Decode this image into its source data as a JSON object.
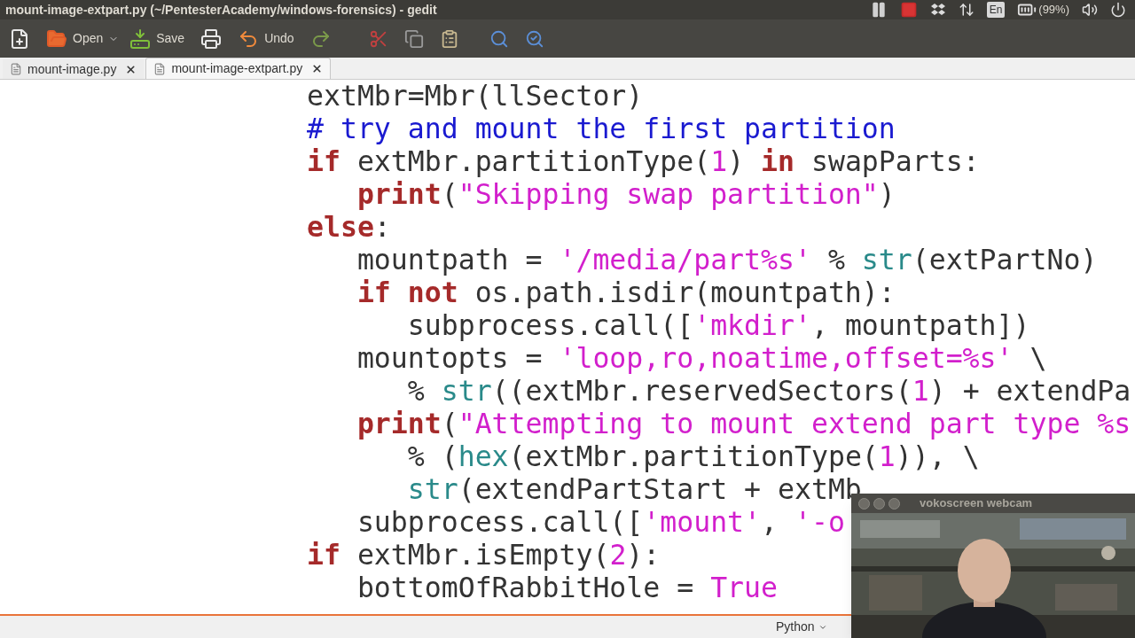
{
  "window": {
    "title": "mount-image-extpart.py (~/PentesterAcademy/windows-forensics) - gedit"
  },
  "panel": {
    "keyboard_layout": "En",
    "battery": "(99%)"
  },
  "toolbar": {
    "open_label": "Open",
    "save_label": "Save",
    "undo_label": "Undo"
  },
  "tabs": [
    {
      "label": "mount-image.py",
      "selected": false
    },
    {
      "label": "mount-image-extpart.py",
      "selected": true
    }
  ],
  "code": [
    {
      "tokens": [
        {
          "t": "extMbr=Mbr(llSector)",
          "kind": "plain"
        }
      ]
    },
    {
      "tokens": [
        {
          "t": "# try and mount the first partition",
          "kind": "comment"
        }
      ]
    },
    {
      "tokens": [
        {
          "t": "if",
          "kind": "keyword"
        },
        {
          "t": " extMbr.partitionType(",
          "kind": "plain"
        },
        {
          "t": "1",
          "kind": "number"
        },
        {
          "t": ") ",
          "kind": "plain"
        },
        {
          "t": "in",
          "kind": "keyword"
        },
        {
          "t": " swapParts:",
          "kind": "plain"
        }
      ],
      "children": [
        {
          "tokens": [
            {
              "t": "print",
              "kind": "keyword"
            },
            {
              "t": "(",
              "kind": "plain"
            },
            {
              "t": "\"Skipping swap partition\"",
              "kind": "string"
            },
            {
              "t": ")",
              "kind": "plain"
            }
          ]
        }
      ]
    },
    {
      "tokens": [
        {
          "t": "else",
          "kind": "keyword"
        },
        {
          "t": ":",
          "kind": "plain"
        }
      ],
      "children": [
        {
          "tokens": [
            {
              "t": "mountpath = ",
              "kind": "plain"
            },
            {
              "t": "'/media/part%s'",
              "kind": "string"
            },
            {
              "t": " % ",
              "kind": "plain"
            },
            {
              "t": "str",
              "kind": "builtin"
            },
            {
              "t": "(extPartNo)",
              "kind": "plain"
            }
          ]
        },
        {
          "tokens": [
            {
              "t": "if",
              "kind": "keyword"
            },
            {
              "t": " not",
              "kind": "keyword"
            },
            {
              "t": " os.path.isdir(mountpath):",
              "kind": "plain"
            }
          ],
          "children": [
            {
              "tokens": [
                {
                  "t": "subprocess.call([",
                  "kind": "plain"
                },
                {
                  "t": "'mkdir'",
                  "kind": "string"
                },
                {
                  "t": ", mountpath])",
                  "kind": "plain"
                }
              ]
            }
          ]
        },
        {
          "tokens": [
            {
              "t": "mountopts = ",
              "kind": "plain"
            },
            {
              "t": "'loop,ro,noatime,offset=%s'",
              "kind": "string"
            },
            {
              "t": " \\",
              "kind": "plain"
            }
          ],
          "children": [
            {
              "tokens": [
                {
                  "t": "% ",
                  "kind": "plain"
                },
                {
                  "t": "str",
                  "kind": "builtin"
                },
                {
                  "t": "((extMbr.reservedSectors(",
                  "kind": "plain"
                },
                {
                  "t": "1",
                  "kind": "number"
                },
                {
                  "t": ") + extendPa",
                  "kind": "plain"
                }
              ]
            }
          ]
        },
        {
          "tokens": [
            {
              "t": "print",
              "kind": "keyword"
            },
            {
              "t": "(",
              "kind": "plain"
            },
            {
              "t": "\"Attempting to mount extend part type %s",
              "kind": "string"
            }
          ],
          "children": [
            {
              "tokens": [
                {
                  "t": "% (",
                  "kind": "plain"
                },
                {
                  "t": "hex",
                  "kind": "builtin"
                },
                {
                  "t": "(extMbr.partitionType(",
                  "kind": "plain"
                },
                {
                  "t": "1",
                  "kind": "number"
                },
                {
                  "t": ")), \\",
                  "kind": "plain"
                }
              ]
            },
            {
              "tokens": [
                {
                  "t": "str",
                  "kind": "builtin"
                },
                {
                  "t": "(extendPartStart + extMb",
                  "kind": "plain"
                }
              ]
            }
          ]
        },
        {
          "tokens": [
            {
              "t": "subprocess.call([",
              "kind": "plain"
            },
            {
              "t": "'mount'",
              "kind": "string"
            },
            {
              "t": ", ",
              "kind": "plain"
            },
            {
              "t": "'-o",
              "kind": "string"
            }
          ]
        }
      ]
    },
    {
      "tokens": [
        {
          "t": "if",
          "kind": "keyword"
        },
        {
          "t": " extMbr.isEmpty(",
          "kind": "plain"
        },
        {
          "t": "2",
          "kind": "number"
        },
        {
          "t": "):",
          "kind": "plain"
        }
      ],
      "children": [
        {
          "tokens": [
            {
              "t": "bottomOfRabbitHole = ",
              "kind": "plain"
            },
            {
              "t": "True",
              "kind": "number"
            }
          ]
        }
      ]
    }
  ],
  "status_bar": {
    "language": "Python"
  },
  "webcam": {
    "title": "vokoscreen webcam",
    "kind": "picture"
  }
}
